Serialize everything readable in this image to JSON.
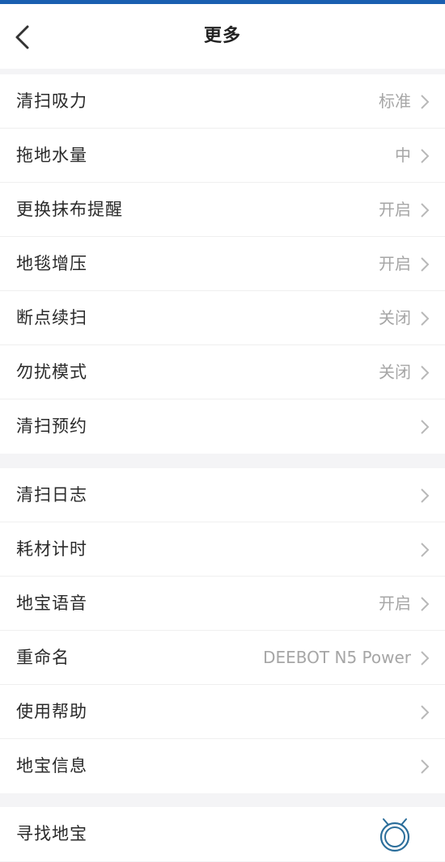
{
  "header": {
    "title": "更多",
    "back_icon": "chevron-left-icon"
  },
  "groups": [
    {
      "items": [
        {
          "label": "清扫吸力",
          "value": "标准"
        },
        {
          "label": "拖地水量",
          "value": "中"
        },
        {
          "label": "更换抹布提醒",
          "value": "开启"
        },
        {
          "label": "地毯增压",
          "value": "开启"
        },
        {
          "label": "断点续扫",
          "value": "关闭"
        },
        {
          "label": "勿扰模式",
          "value": "关闭"
        },
        {
          "label": "清扫预约",
          "value": ""
        }
      ]
    },
    {
      "items": [
        {
          "label": "清扫日志",
          "value": ""
        },
        {
          "label": "耗材计时",
          "value": ""
        },
        {
          "label": "地宝语音",
          "value": "开启"
        },
        {
          "label": "重命名",
          "value": "DEEBOT N5 Power"
        },
        {
          "label": "使用帮助",
          "value": ""
        },
        {
          "label": "地宝信息",
          "value": ""
        }
      ]
    },
    {
      "items": [
        {
          "label": "寻找地宝",
          "icon": "robot-vacuum-icon"
        }
      ]
    }
  ],
  "colors": {
    "accent": "#1a5fb0",
    "robot_icon": "#2b6e9b",
    "value_text": "#a6a6a6",
    "chevron": "#b8b8b8"
  }
}
